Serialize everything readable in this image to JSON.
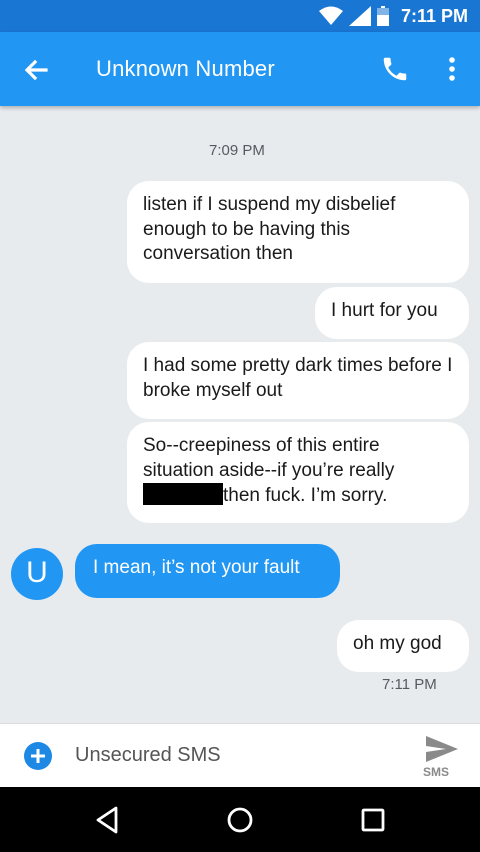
{
  "status": {
    "time": "7:11 PM"
  },
  "appbar": {
    "title": "Unknown Number"
  },
  "conversation": {
    "timestamp_top": "7:09 PM",
    "messages": [
      {
        "from": "contact",
        "text": "listen if I suspend my disbelief enough to be having this conversation then"
      },
      {
        "from": "contact",
        "text": "I hurt for you"
      },
      {
        "from": "contact",
        "text": "I had some pretty dark times before I broke myself out"
      },
      {
        "from": "contact",
        "text_before": "So--creepiness of this entire situation aside--if you’re really",
        "text_after": "then fuck. I’m sorry."
      },
      {
        "from": "me",
        "text": "I mean, it’s not your fault"
      },
      {
        "from": "contact",
        "text": "oh my god"
      }
    ],
    "avatar_letter": "U",
    "timestamp_bottom": "7:11 PM"
  },
  "composer": {
    "placeholder": "Unsecured SMS",
    "send_label": "SMS"
  },
  "colors": {
    "accent": "#2196f3",
    "statusbar": "#1976d2",
    "background": "#e8ebee"
  }
}
